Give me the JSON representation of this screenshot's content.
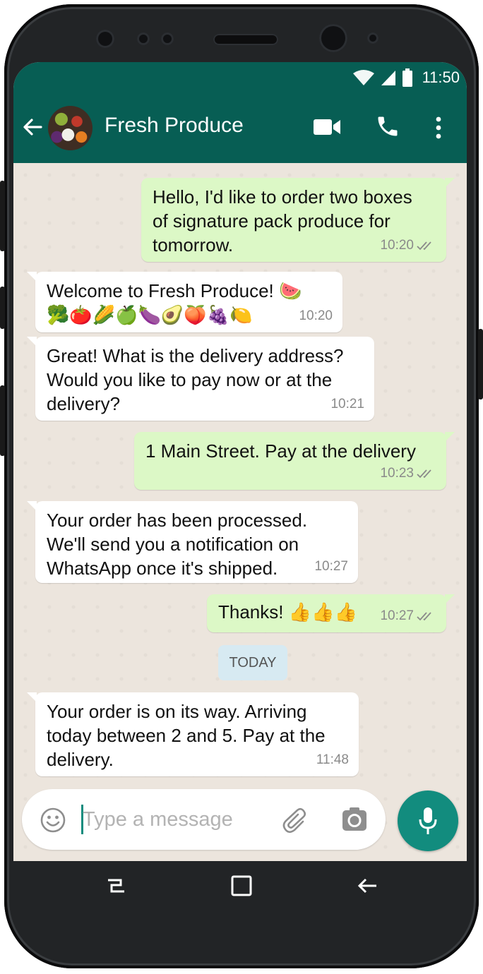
{
  "status_bar": {
    "time": "11:50"
  },
  "header": {
    "contact_name": "Fresh Produce"
  },
  "messages": [
    {
      "direction": "outgoing",
      "text": "Hello, I'd like to order two boxes\nof signature pack produce for\ntomorrow.",
      "time": "10:20",
      "ticks": "double"
    },
    {
      "direction": "incoming",
      "text": "Welcome to Fresh Produce! 🍉\n🥦🍅🌽🍏🍆🥑🍑🍇🍋",
      "time": "10:20"
    },
    {
      "direction": "incoming",
      "text": "Great! What is the delivery address?\nWould you like to pay now or at the\ndelivery?",
      "time": "10:21"
    },
    {
      "direction": "outgoing",
      "text": "1 Main Street. Pay at the delivery",
      "time": "10:23",
      "ticks": "double"
    },
    {
      "direction": "incoming",
      "text": "Your order has been processed.\nWe'll send you a notification on\nWhatsApp once it's shipped.",
      "time": "10:27"
    },
    {
      "direction": "outgoing",
      "text": "Thanks! 👍👍👍",
      "time": "10:27",
      "ticks": "double"
    },
    {
      "direction": "incoming",
      "text": "Your order is on its way. Arriving\ntoday between 2 and 5. Pay at the\ndelivery.",
      "time": "11:48"
    }
  ],
  "date_separator": "TODAY",
  "composer": {
    "placeholder": "Type a message"
  },
  "icons": {
    "status": [
      "wifi-icon",
      "signal-icon",
      "battery-icon"
    ],
    "header": [
      "back-arrow-icon",
      "video-call-icon",
      "phone-call-icon",
      "more-options-icon"
    ],
    "composer": [
      "emoji-icon",
      "attach-icon",
      "camera-icon",
      "mic-icon"
    ],
    "nav": [
      "recent-apps-icon",
      "home-icon",
      "back-icon"
    ]
  },
  "colors": {
    "header": "#075e54",
    "outgoing_bubble": "#dcf8c6",
    "incoming_bubble": "#ffffff",
    "chat_background": "#ece5dd",
    "accent": "#128c7e",
    "date_pill": "#d7eaf2"
  }
}
